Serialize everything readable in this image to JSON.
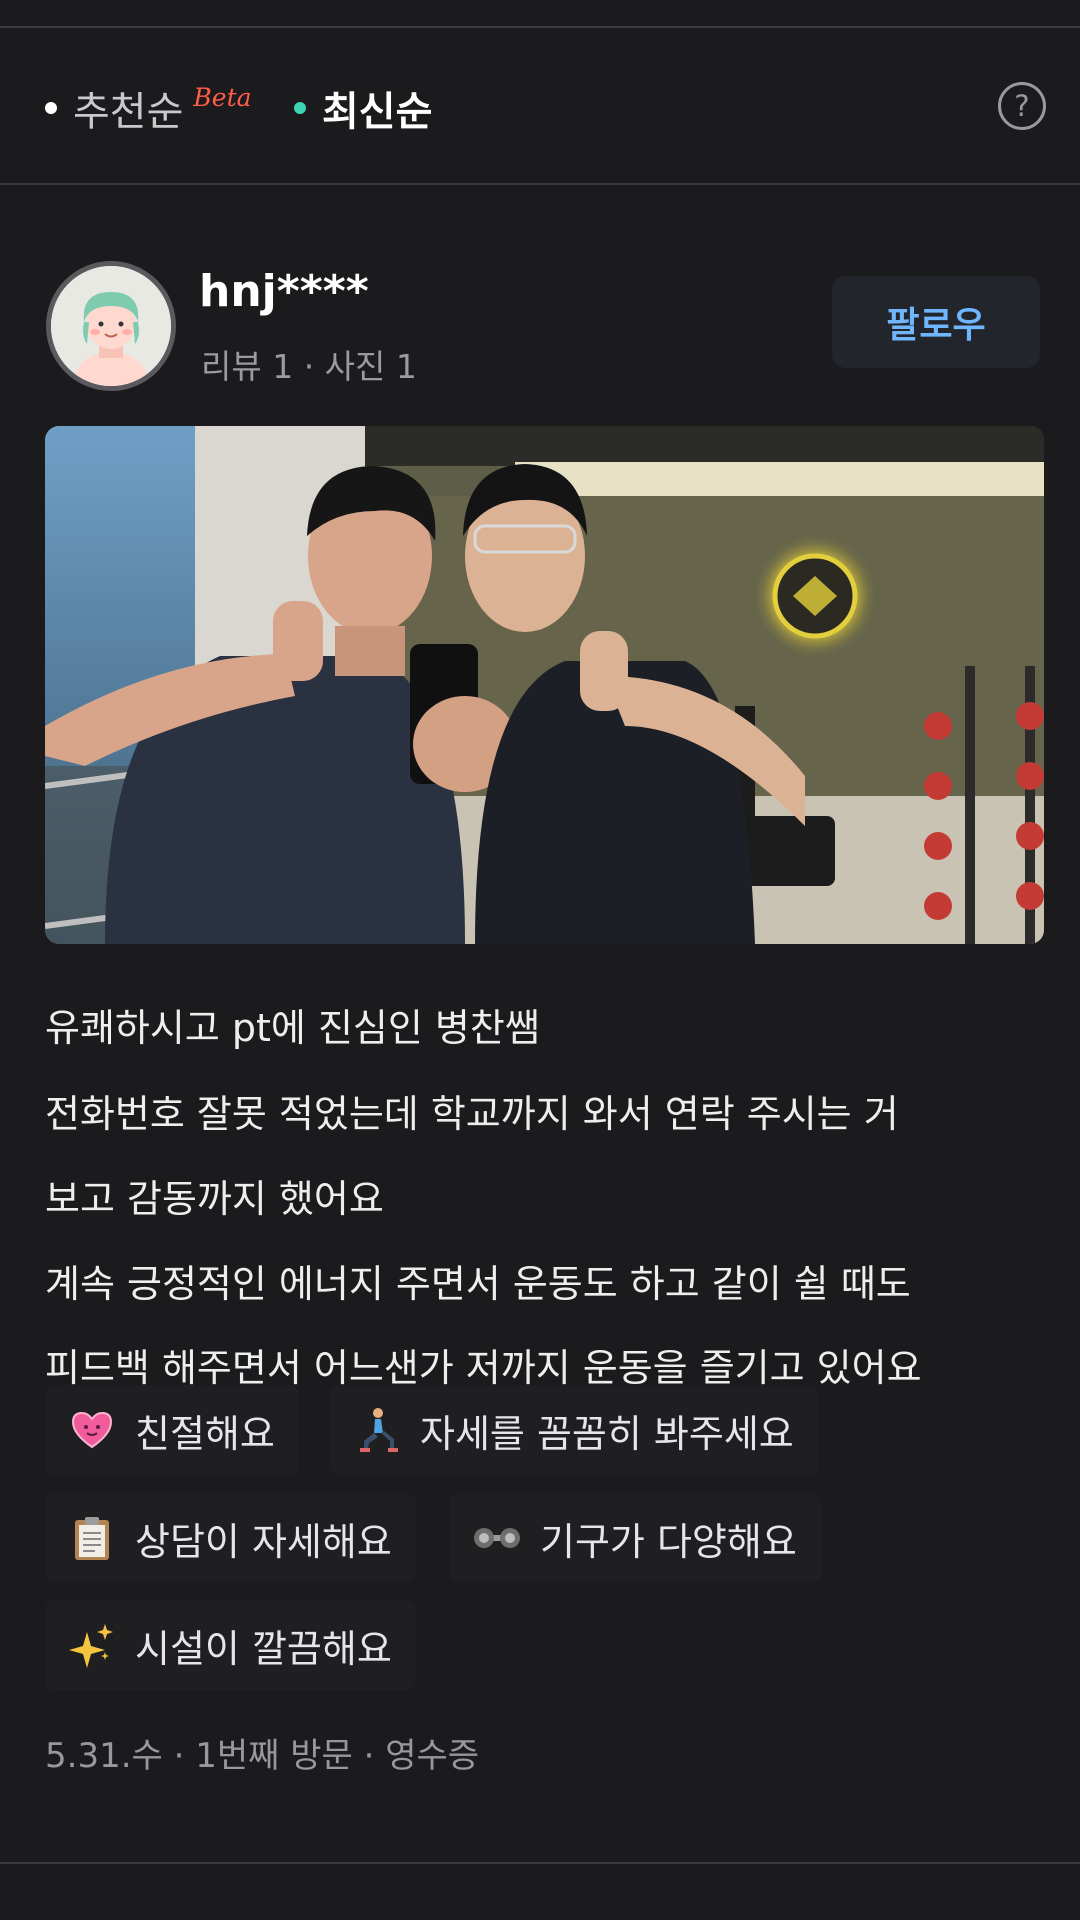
{
  "sort": {
    "options": [
      {
        "label": "추천순",
        "badge": "Beta",
        "dot_color": "#ffffff"
      },
      {
        "label": "최신순",
        "dot_color": "#3ed3b5"
      }
    ],
    "help_label": "?"
  },
  "review": {
    "user": {
      "name": "hnj****",
      "stats": "리뷰 1 · 사진 1"
    },
    "follow_label": "팔로우",
    "text_lines": [
      "유쾌하시고 pt에 진심인 병찬쌤",
      "전화번호 잘못 적었는데 학교까지 와서 연락 주시는 거",
      "보고 감동까지 했어요",
      "계속 긍정적인 에너지 주면서 운동도 하고 같이 쉴 때도",
      "피드백 해주면서 어느샌가 저까지 운동을 즐기고 있어요"
    ],
    "tags": [
      {
        "icon": "heart-icon",
        "label": "친절해요"
      },
      {
        "icon": "lunge-person-icon",
        "label": "자세를 꼼꼼히 봐주세요"
      },
      {
        "icon": "clipboard-icon",
        "label": "상담이 자세해요"
      },
      {
        "icon": "dumbbell-icon",
        "label": "기구가 다양해요"
      },
      {
        "icon": "sparkles-icon",
        "label": "시설이 깔끔해요"
      }
    ],
    "meta": "5.31.수 · 1번째 방문 · 영수증"
  }
}
